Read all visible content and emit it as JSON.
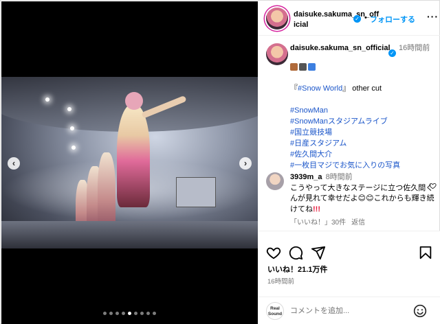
{
  "header": {
    "username": "daisuke.sakuma_sn_official",
    "separator": "•",
    "follow_label": "フォローする",
    "more_label": "···"
  },
  "carousel": {
    "prev_label": "‹",
    "next_label": "›",
    "slide_count": 9,
    "active_slide": 4
  },
  "caption": {
    "username": "daisuke.sakuma_sn_official",
    "time": "16時間前",
    "emoji_icons": [
      "cake-icon",
      "camera-icon",
      "info-icon"
    ],
    "title_part1": "『",
    "title_tag": "#Snow World",
    "title_part2": "』 other cut",
    "hashtags": [
      "#SnowMan",
      "#SnowManスタジアムライブ",
      "#国立競技場",
      "#日産スタジアム",
      "#佐久間大介",
      "#一枚目マジでお気に入りの写真"
    ]
  },
  "comment1": {
    "username": "3939m_a",
    "time": "8時間前",
    "text": "こうやって大きなステージに立つ佐久間くんが見れて幸せだよ",
    "text_end": "これからも輝き続けてね",
    "marks": "!!!",
    "likes": "「いいね！」30件",
    "reply": "返信"
  },
  "actions": {
    "likes_label": "いいね！21.1万件",
    "post_time": "16時間前"
  },
  "composer": {
    "logo_text": "Real Sound",
    "placeholder": "コメントを追加...",
    "value": ""
  },
  "colors": {
    "accent": "#0095f6",
    "hashtag": "#1a55c9",
    "muted": "#737373",
    "alert": "#e5183a"
  }
}
